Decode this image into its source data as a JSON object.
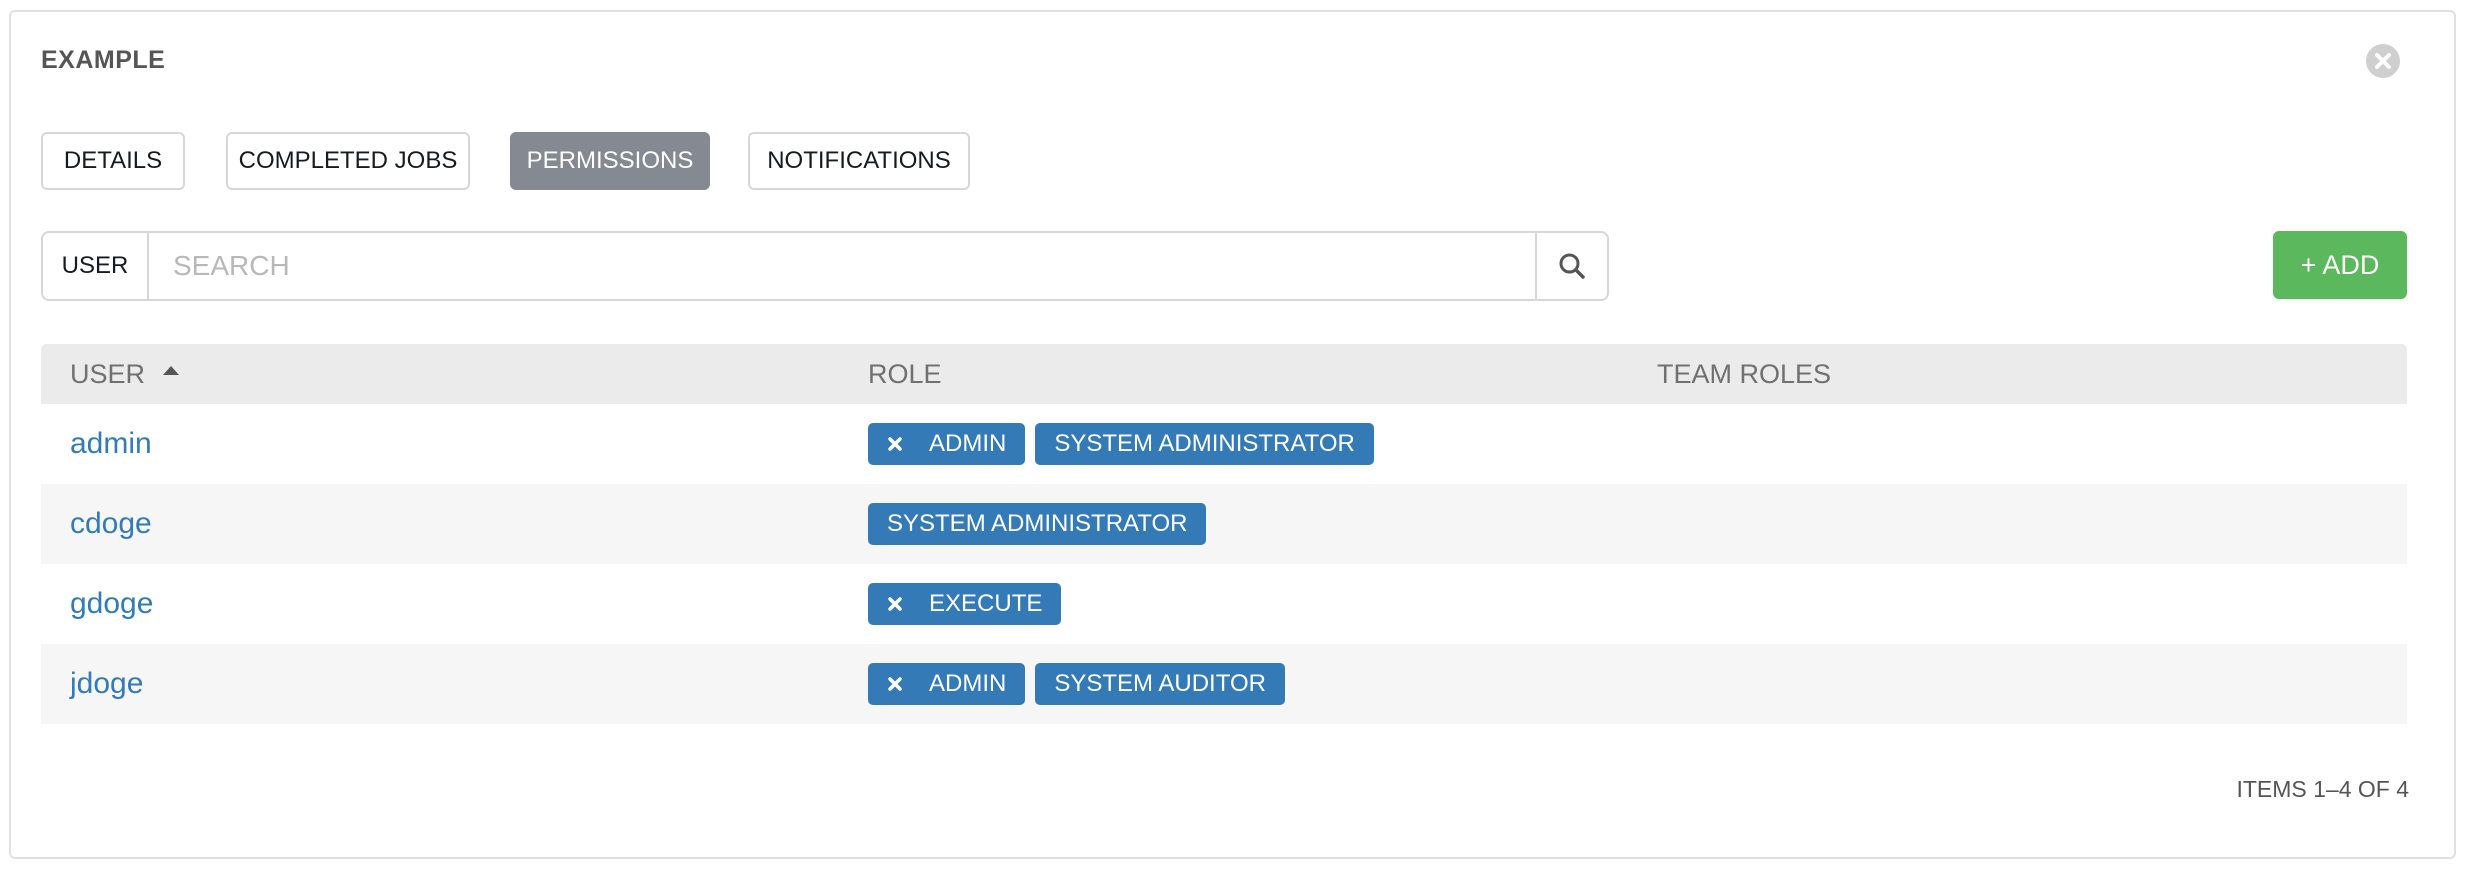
{
  "panel": {
    "title": "EXAMPLE"
  },
  "tabs": [
    {
      "label": "DETAILS",
      "active": false
    },
    {
      "label": "COMPLETED JOBS",
      "active": false
    },
    {
      "label": "PERMISSIONS",
      "active": true
    },
    {
      "label": "NOTIFICATIONS",
      "active": false
    }
  ],
  "search": {
    "key_label": "USER",
    "placeholder": "SEARCH",
    "value": ""
  },
  "add_button": {
    "label": "+ ADD"
  },
  "table": {
    "columns": [
      "USER",
      "ROLE",
      "TEAM ROLES"
    ],
    "rows": [
      {
        "user": "admin",
        "roles": [
          {
            "label": "ADMIN",
            "removable": true
          },
          {
            "label": "SYSTEM ADMINISTRATOR",
            "removable": false
          }
        ]
      },
      {
        "user": "cdoge",
        "roles": [
          {
            "label": "SYSTEM ADMINISTRATOR",
            "removable": false
          }
        ]
      },
      {
        "user": "gdoge",
        "roles": [
          {
            "label": "EXECUTE",
            "removable": true
          }
        ]
      },
      {
        "user": "jdoge",
        "roles": [
          {
            "label": "ADMIN",
            "removable": true
          },
          {
            "label": "SYSTEM AUDITOR",
            "removable": false
          }
        ]
      }
    ]
  },
  "pager": {
    "text": "ITEMS 1–4 OF 4"
  },
  "colors": {
    "accent_blue": "#337ab7",
    "add_green": "#5cb85c",
    "active_tab": "#848992"
  },
  "icons": {
    "close": "close-circle-icon",
    "search": "search-icon",
    "sort": "sort-ascending-icon",
    "remove": "remove-x-icon"
  }
}
